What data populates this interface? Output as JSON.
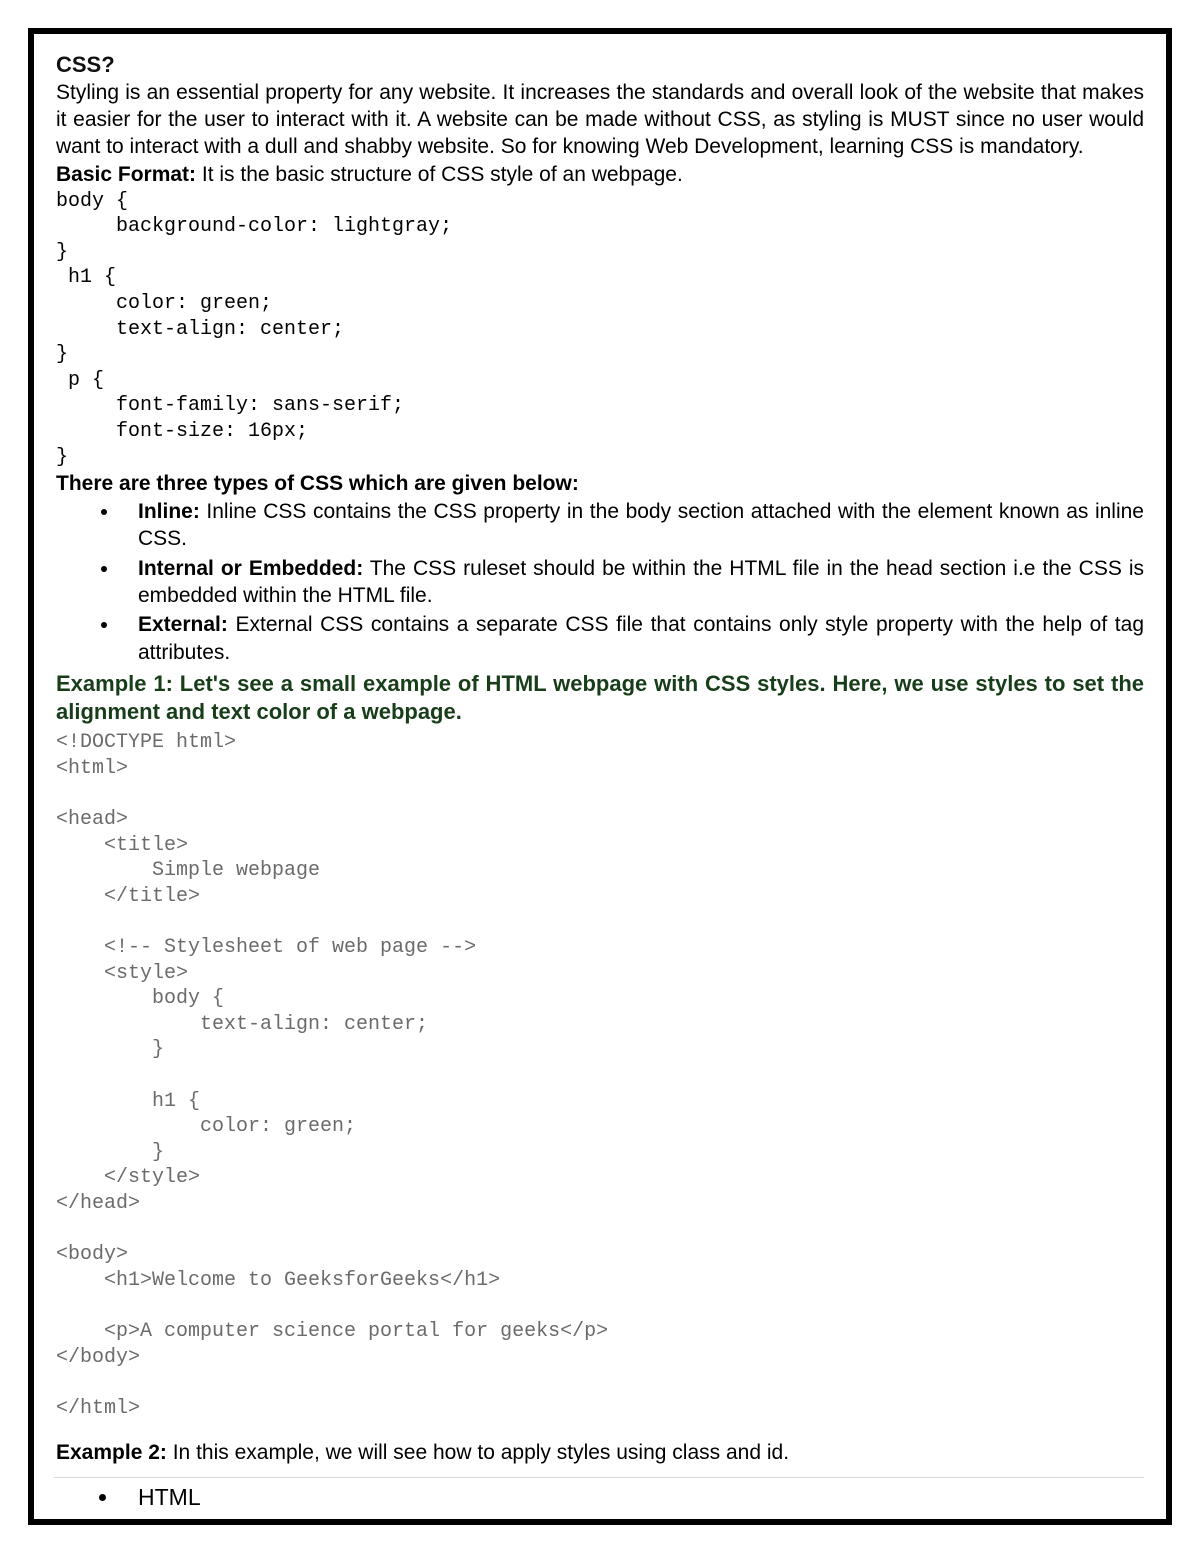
{
  "heading": "CSS?",
  "intro_para": "Styling is an essential property for any website. It increases the standards and overall look of the website that makes it easier for the user to interact with it. A website can be made without CSS, as styling is MUST since no user would want to interact with a dull and shabby website. So for knowing Web Development, learning CSS is mandatory.",
  "basic_format": {
    "label": "Basic Format:",
    "text": " It is the basic structure of CSS style of an webpage."
  },
  "code1": "body {\n     background-color: lightgray;\n}\n h1 {\n     color: green;\n     text-align: center;\n}\n p {\n     font-family: sans-serif;\n     font-size: 16px;\n}",
  "types_heading": "There are three types of CSS which are given below:",
  "types": [
    {
      "name": "Inline:",
      "desc": " Inline CSS contains the CSS property in the body section attached with the element known as inline CSS."
    },
    {
      "name": "Internal or Embedded:",
      "desc": " The CSS ruleset should be within the HTML file in the head section i.e the CSS is embedded within the HTML file."
    },
    {
      "name": "External:",
      "desc": " External CSS contains a separate CSS file that contains only style property with the help of tag attributes."
    }
  ],
  "example1_heading": "Example 1: Let's see a small example of HTML webpage with CSS styles. Here, we use styles to set the alignment and text color of a webpage.",
  "code2": "<!DOCTYPE html>\n<html>\n\n<head>\n    <title>\n        Simple webpage\n    </title>\n\n    <!-- Stylesheet of web page -->\n    <style>\n        body {\n            text-align: center;\n        }\n\n        h1 {\n            color: green;\n        }\n    </style>\n</head>\n\n<body>\n    <h1>Welcome to GeeksforGeeks</h1>\n\n    <p>A computer science portal for geeks</p>\n</body>\n\n</html>",
  "example2": {
    "label": "Example 2:",
    "text": " In this example, we will see how to apply styles using class and id."
  },
  "ex2_list_item": "HTML"
}
